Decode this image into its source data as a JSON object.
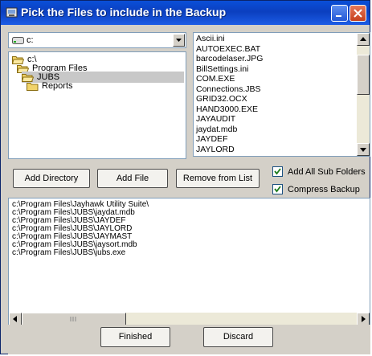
{
  "window": {
    "title": "Pick the Files to include in the Backup"
  },
  "drive": {
    "selected": "c:"
  },
  "tree": [
    {
      "label": "c:\\",
      "level": 0,
      "open": true,
      "selected": false
    },
    {
      "label": "Program Files",
      "level": 1,
      "open": true,
      "selected": false
    },
    {
      "label": "JUBS",
      "level": 2,
      "open": true,
      "selected": true
    },
    {
      "label": "Reports",
      "level": 3,
      "open": false,
      "selected": false
    }
  ],
  "files": [
    "Ascii.ini",
    "AUTOEXEC.BAT",
    "barcodelaser.JPG",
    "BillSettings.ini",
    "COM.EXE",
    "Connections.JBS",
    "GRID32.OCX",
    "HAND3000.EXE",
    "JAYAUDIT",
    "jaydat.mdb",
    "JAYDEF",
    "JAYLORD"
  ],
  "buttons": {
    "add_directory": "Add Directory",
    "add_file": "Add File",
    "remove": "Remove from List",
    "finished": "Finished",
    "discard": "Discard"
  },
  "options": {
    "add_all_subfolders": {
      "label": "Add All Sub Folders",
      "checked": true
    },
    "compress_backup": {
      "label": "Compress Backup",
      "checked": true
    }
  },
  "selected_files": [
    "c:\\Program Files\\Jayhawk Utility Suite\\",
    "c:\\Program Files\\JUBS\\jaydat.mdb",
    "c:\\Program Files\\JUBS\\JAYDEF",
    "c:\\Program Files\\JUBS\\JAYLORD",
    "c:\\Program Files\\JUBS\\JAYMAST",
    "c:\\Program Files\\JUBS\\jaysort.mdb",
    "c:\\Program Files\\JUBS\\jubs.exe"
  ]
}
